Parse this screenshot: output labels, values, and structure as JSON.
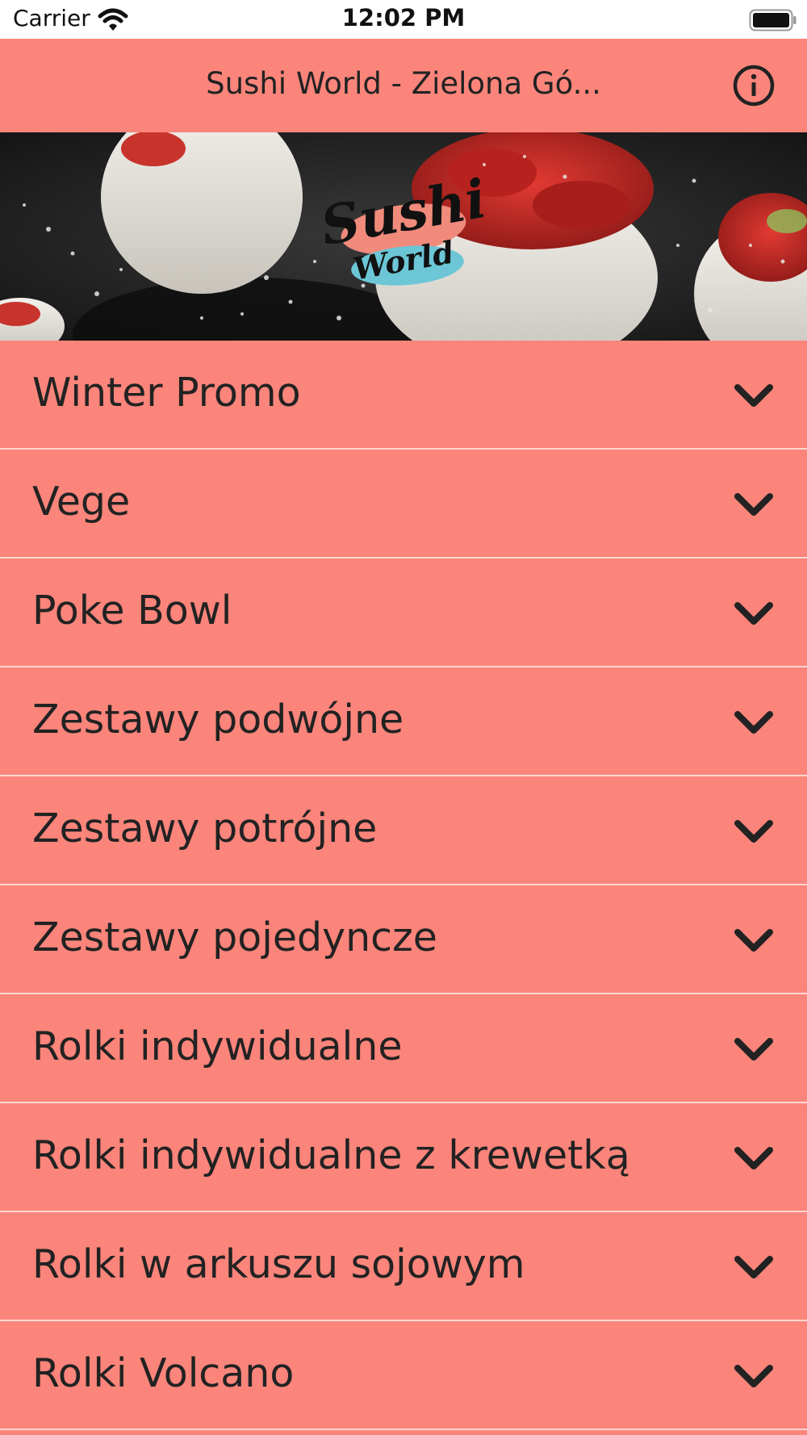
{
  "status_bar": {
    "carrier": "Carrier",
    "time": "12:02 PM",
    "wifi_icon": "wifi-icon",
    "battery_icon": "battery-icon"
  },
  "nav": {
    "title": "Sushi World - Zielona Gó...",
    "info_icon": "info-icon"
  },
  "banner": {
    "logo_line1": "Sushi",
    "logo_line2": "World"
  },
  "categories": [
    {
      "label": "Winter Promo"
    },
    {
      "label": "Vege"
    },
    {
      "label": "Poke Bowl"
    },
    {
      "label": "Zestawy podwójne"
    },
    {
      "label": "Zestawy potrójne"
    },
    {
      "label": "Zestawy pojedyncze"
    },
    {
      "label": "Rolki indywidualne"
    },
    {
      "label": "Rolki indywidualne z krewetką"
    },
    {
      "label": "Rolki w arkuszu sojowym"
    },
    {
      "label": "Rolki Volcano"
    }
  ],
  "colors": {
    "background": "#fb857b",
    "separator": "#fbd7d2",
    "text": "#222222",
    "status_bar": "#ffffff"
  }
}
